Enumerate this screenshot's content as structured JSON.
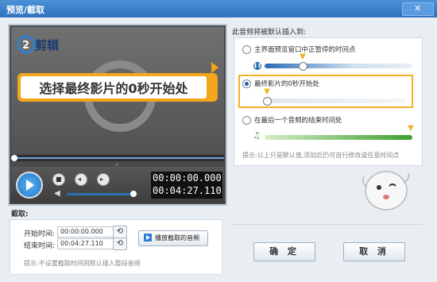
{
  "window": {
    "title": "预览/截取"
  },
  "preview": {
    "logo_text": "剪辑",
    "banner_text": "选择最终影片的0秒开始处",
    "time_current": "00:00:00.000",
    "time_total": "00:04:27.110"
  },
  "crop": {
    "section_label": "截取:",
    "start_label": "开始时间:",
    "start_value": "00:00:00.000",
    "end_label": "结束时间:",
    "end_value": "00:04:27.110",
    "play_button": "播放截取的音频",
    "hint": "提示:不设置截取时间则默认插入整段音频"
  },
  "insert": {
    "title": "此音频将被默认插入到:",
    "options": [
      {
        "label": "主界面预览窗口中正暂停的时间点",
        "selected": false
      },
      {
        "label": "最终影片的0秒开始处",
        "selected": true
      },
      {
        "label": "在最后一个音频的结束时间处",
        "selected": false
      }
    ],
    "hint": "提示:以上只是默认值,添加后仍可自行修改或任意时间点"
  },
  "buttons": {
    "ok": "确 定",
    "cancel": "取 消"
  },
  "colors": {
    "accent": "#f2b227",
    "title_bar": "#3a80c8",
    "green": "#4aa33a"
  }
}
